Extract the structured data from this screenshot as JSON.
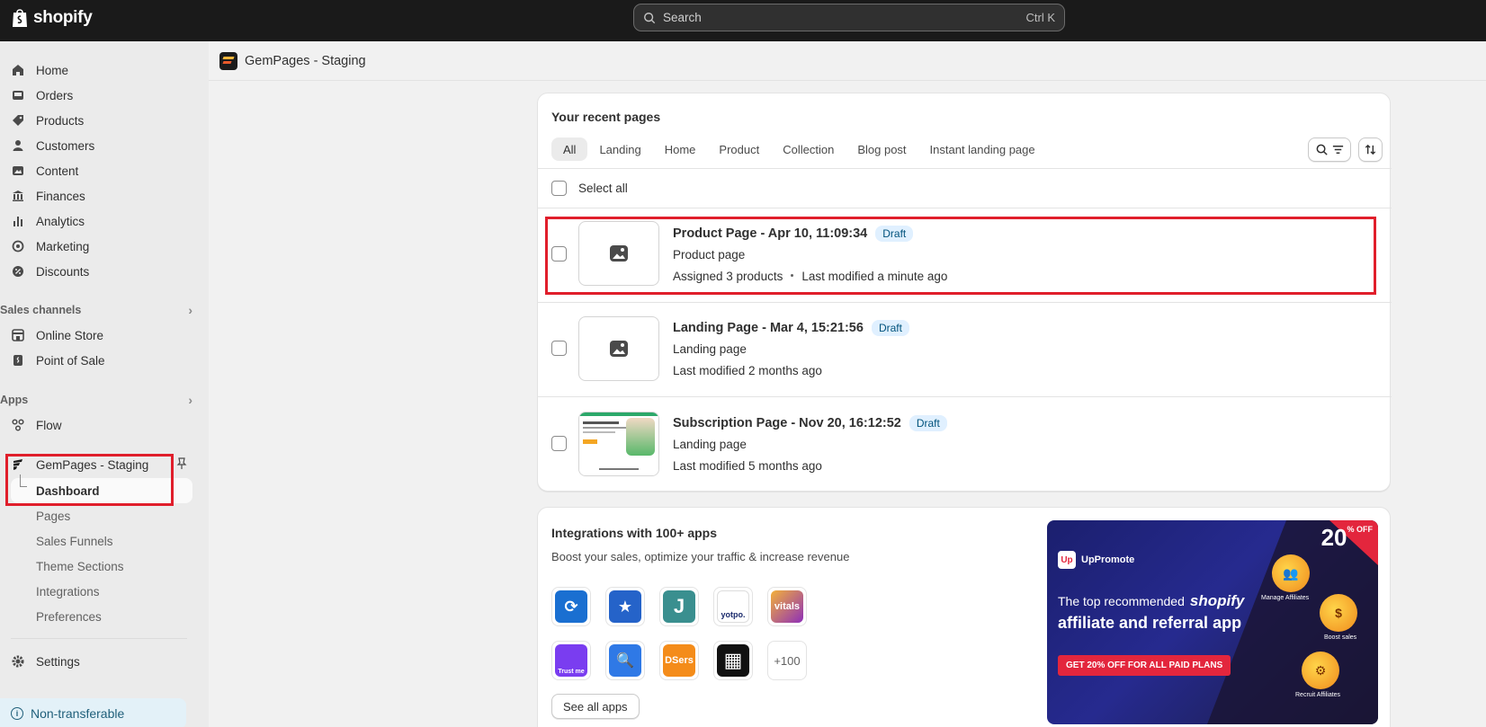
{
  "topbar": {
    "brand": "shopify",
    "search_placeholder": "Search",
    "search_shortcut": "Ctrl K"
  },
  "sidebar": {
    "main_items": [
      {
        "label": "Home",
        "icon": "home-icon"
      },
      {
        "label": "Orders",
        "icon": "inbox-icon"
      },
      {
        "label": "Products",
        "icon": "tag-icon"
      },
      {
        "label": "Customers",
        "icon": "person-icon"
      },
      {
        "label": "Content",
        "icon": "image-icon"
      },
      {
        "label": "Finances",
        "icon": "bank-icon"
      },
      {
        "label": "Analytics",
        "icon": "bar-chart-icon"
      },
      {
        "label": "Marketing",
        "icon": "target-icon"
      },
      {
        "label": "Discounts",
        "icon": "discount-icon"
      }
    ],
    "sales_channels_title": "Sales channels",
    "sales_channels": [
      {
        "label": "Online Store",
        "icon": "store-icon"
      },
      {
        "label": "Point of Sale",
        "icon": "pos-icon"
      }
    ],
    "apps_title": "Apps",
    "apps": [
      {
        "label": "Flow",
        "icon": "flow-icon"
      }
    ],
    "gempages": {
      "label": "GemPages - Staging",
      "subitems": [
        "Dashboard",
        "Pages",
        "Sales Funnels",
        "Theme Sections",
        "Integrations",
        "Preferences"
      ],
      "active_subitem": "Dashboard"
    },
    "settings_label": "Settings",
    "non_transferable": "Non-transferable"
  },
  "app_header": {
    "title": "GemPages - Staging"
  },
  "recent_pages": {
    "title": "Your recent pages",
    "tabs": [
      "All",
      "Landing",
      "Home",
      "Product",
      "Collection",
      "Blog post",
      "Instant landing page"
    ],
    "active_tab": "All",
    "select_all": "Select all",
    "rows": [
      {
        "title": "Product Page - Apr 10, 11:09:34",
        "status": "Draft",
        "type": "Product page",
        "meta_1": "Assigned 3 products",
        "meta_2": "Last modified a minute ago"
      },
      {
        "title": "Landing Page - Mar 4, 15:21:56",
        "status": "Draft",
        "type": "Landing page",
        "meta_2": "Last modified 2 months ago"
      },
      {
        "title": "Subscription Page - Nov 20, 16:12:52",
        "status": "Draft",
        "type": "Landing page",
        "meta_2": "Last modified 5 months ago"
      }
    ]
  },
  "integrations": {
    "title": "Integrations with 100+ apps",
    "subtitle": "Boost your sales, optimize your traffic & increase revenue",
    "app_tiles": [
      {
        "name": "recharge",
        "color": "#1a6fd1",
        "text": "⟳"
      },
      {
        "name": "judge",
        "color": "#2563c9",
        "text": "★"
      },
      {
        "name": "judgeme",
        "color": "#3a8f8f",
        "text": "J"
      },
      {
        "name": "yotpo",
        "color": "#ffffff",
        "text": "yotpo."
      },
      {
        "name": "vitals",
        "color": "#e8552b",
        "text": "vitals"
      },
      {
        "name": "trustme",
        "color": "#7a3df0",
        "text": "Trust me"
      },
      {
        "name": "search",
        "color": "#2f79e6",
        "text": "🔍"
      },
      {
        "name": "dsers",
        "color": "#f48c1a",
        "text": "DSers"
      },
      {
        "name": "grid",
        "color": "#111111",
        "text": "▦"
      }
    ],
    "more_label": "+100",
    "see_all": "See all apps",
    "banner": {
      "discount": "20",
      "discount_unit": "% OFF",
      "brand": "UpPromote",
      "top_line": "The top recommended",
      "platform": "shopify",
      "headline": "affiliate and referral app",
      "cta": "GET 20% OFF FOR ALL PAID PLANS",
      "features": [
        "Manage Affiliates",
        "Boost sales",
        "Recruit Affiliates"
      ]
    }
  }
}
